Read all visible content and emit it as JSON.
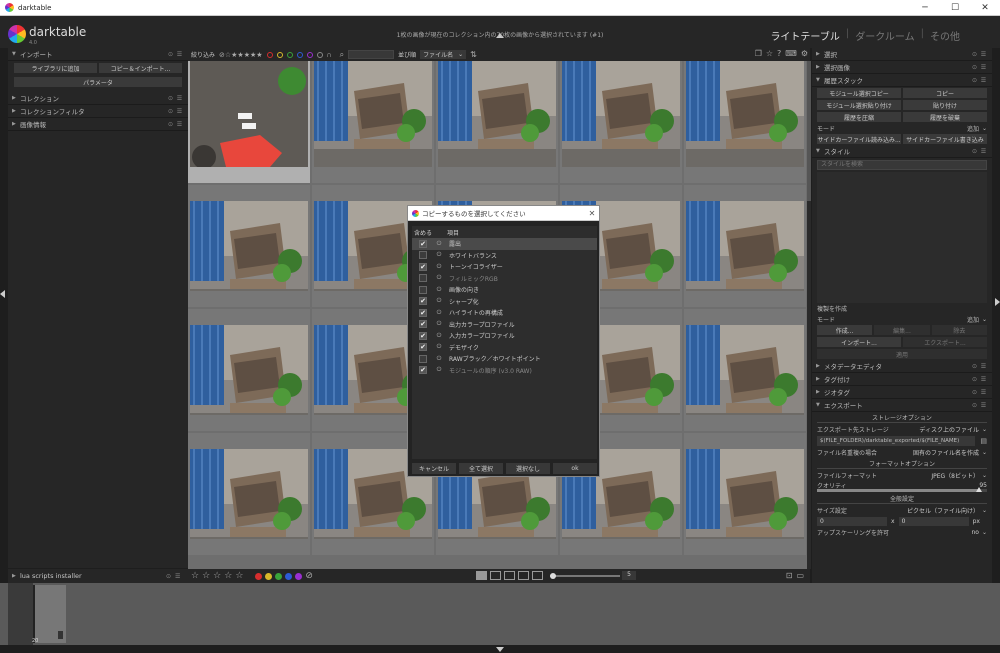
{
  "window": {
    "title": "darktable",
    "controls": [
      "─",
      "☐",
      "✕"
    ]
  },
  "header": {
    "logo_text": "darktable",
    "version": "4.0",
    "status": "1枚の画像が現在のコレクション内の70枚の画像から選択されています (#1)",
    "views": {
      "lighttable": "ライトテーブル",
      "darkroom": "ダークルーム",
      "other": "その他",
      "sep": "|"
    }
  },
  "left_panel": {
    "import": {
      "title": "インポート",
      "add_to_library": "ライブラリに追加",
      "copy_import": "コピー＆インポート...",
      "params": "パラメータ"
    },
    "modules": [
      {
        "label": "コレクション"
      },
      {
        "label": "コレクションフィルタ"
      },
      {
        "label": "画像情報"
      }
    ],
    "bottom_label": "lua scripts installer"
  },
  "toolbar": {
    "filter_label": "絞り込み",
    "rating": "⊘☆★★★★★",
    "sort_label": "並び順",
    "sort_value": "ファイル名",
    "sort_arrow": "⌄"
  },
  "colors": {
    "red": "#d62e2e",
    "yellow": "#d8b82a",
    "green": "#3aa33a",
    "blue": "#2d5bd6",
    "purple": "#9a2fd0",
    "gray": "#888888"
  },
  "bottombar": {
    "stars": [
      "☆",
      "☆",
      "☆",
      "☆",
      "☆"
    ],
    "reject": "⊘",
    "zoom_value": "5"
  },
  "grid": {
    "thumbs": [
      {
        "scene": "ground"
      },
      {
        "scene": "crate"
      },
      {
        "scene": "crate"
      },
      {
        "scene": "crate"
      },
      {
        "scene": "crate"
      },
      {
        "scene": "crate"
      },
      {
        "scene": "crate"
      },
      {
        "scene": "crate"
      },
      {
        "scene": "crate"
      },
      {
        "scene": "crate"
      },
      {
        "scene": "crate"
      },
      {
        "scene": "crate"
      },
      {
        "scene": "crate"
      },
      {
        "scene": "crate"
      },
      {
        "scene": "crate"
      },
      {
        "scene": "crate"
      },
      {
        "scene": "crate"
      },
      {
        "scene": "crate"
      },
      {
        "scene": "crate"
      },
      {
        "scene": "crate"
      }
    ]
  },
  "filmstrip": {
    "count_label": "20"
  },
  "right_panel": {
    "select": "選択",
    "select_image": "選択画像",
    "history": {
      "title": "履歴スタック",
      "copy_partial": "モジュール選択コピー",
      "copy": "コピー",
      "paste_partial": "モジュール選択貼り付け",
      "paste": "貼り付け",
      "compress": "履歴を圧縮",
      "discard": "履歴を破棄",
      "mode_label": "モード",
      "mode_value": "追加",
      "load_sidecar": "サイドカーファイル読み込み...",
      "write_sidecar": "サイドカーファイル書き込み"
    },
    "styles": {
      "title": "スタイル",
      "search_placeholder": "スタイルを検索",
      "create_duplicate": "複製を作成",
      "mode_label": "モード",
      "mode_value": "追加",
      "create": "作成...",
      "edit": "編集...",
      "remove": "除去",
      "import": "インポート...",
      "export": "エクスポート...",
      "apply": "適用"
    },
    "metadata": "メタデータエディタ",
    "tagging": "タグ付け",
    "geotag": "ジオタグ",
    "export": {
      "title": "エクスポート",
      "storage_options": "ストレージオプション",
      "target_label": "エクスポート先ストレージ",
      "target_value": "ディスク上のファイル",
      "path": "$(FILE_FOLDER)/darktable_exported/$(FILE_NAME)",
      "on_conflict_label": "ファイル名重複の場合",
      "on_conflict_value": "固有のファイル名を作成",
      "format_options": "フォーマットオプション",
      "format_label": "ファイルフォーマット",
      "format_value": "JPEG（8ビット）",
      "quality_label": "クオリティ",
      "quality_value": "95",
      "quality": 0.95,
      "global_options": "全般設定",
      "size_label": "サイズ設定",
      "size_value": "ピクセル（ファイル向け）",
      "width": "0",
      "height": "0",
      "x": "x",
      "px": "px",
      "upscale_label": "アップスケーリングを許可",
      "upscale_value": "no"
    }
  },
  "dialog": {
    "title": "コピーするものを選択してください",
    "col_include": "含める",
    "col_item": "項目",
    "items": [
      {
        "name": "露出",
        "checked": true
      },
      {
        "name": "ホワイトバランス",
        "checked": false
      },
      {
        "name": "トーンイコライザー",
        "checked": true
      },
      {
        "name": "フィルミックRGB",
        "checked": false,
        "dim": true
      },
      {
        "name": "画像の向き",
        "checked": false
      },
      {
        "name": "シャープ化",
        "checked": true
      },
      {
        "name": "ハイライトの再構成",
        "checked": true
      },
      {
        "name": "出力カラープロファイル",
        "checked": true
      },
      {
        "name": "入力カラープロファイル",
        "checked": true
      },
      {
        "name": "デモザイク",
        "checked": true
      },
      {
        "name": "RAWブラック／ホワイトポイント",
        "checked": false
      },
      {
        "name": "モジュールの順序 (v3.0 RAW)",
        "checked": true,
        "dim": true
      }
    ],
    "buttons": {
      "cancel": "キャンセル",
      "select_all": "全て選択",
      "select_none": "選択なし",
      "ok": "ok"
    }
  }
}
